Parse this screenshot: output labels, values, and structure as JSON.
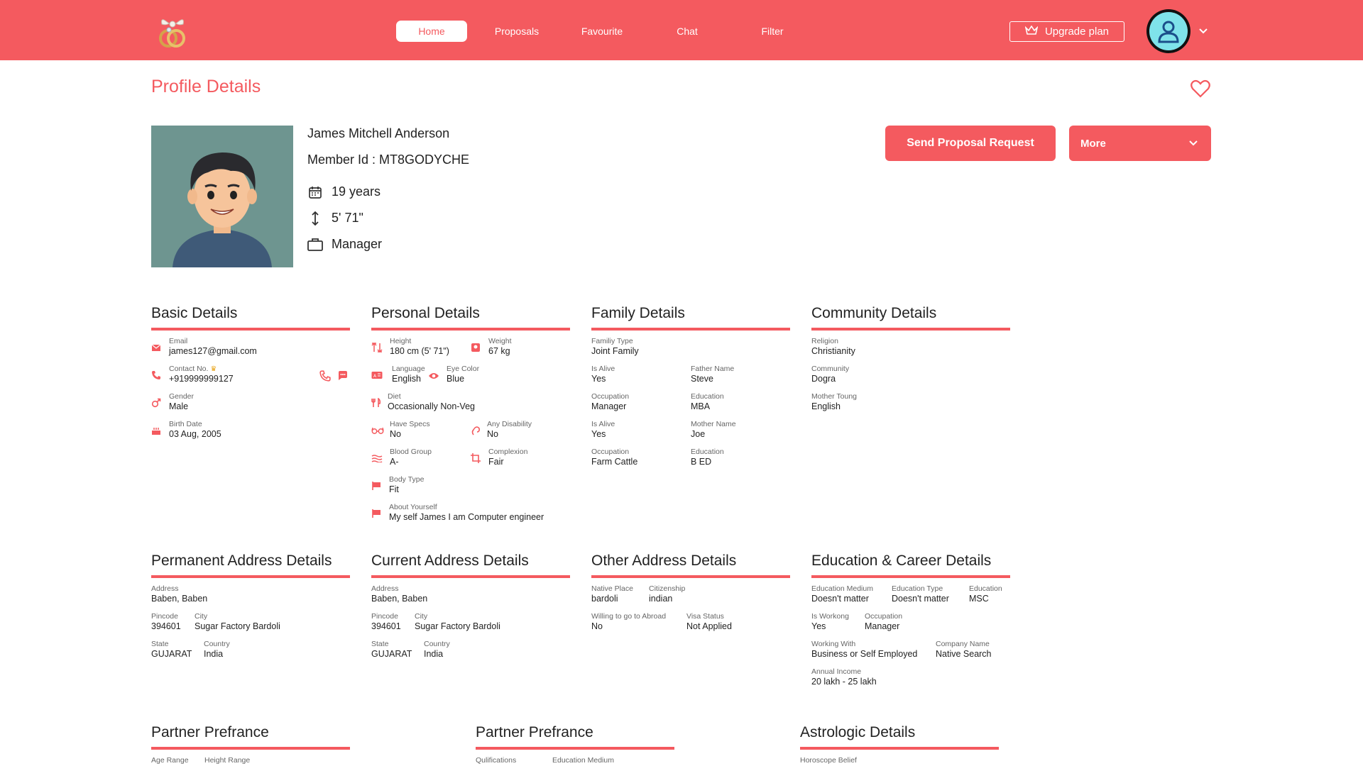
{
  "header": {
    "nav": [
      "Home",
      "Proposals",
      "Favourite",
      "Chat",
      "Filter"
    ],
    "active_nav": "Home",
    "upgrade_label": "Upgrade plan"
  },
  "page_title": "Profile Details",
  "profile": {
    "name": "James Mitchell Anderson",
    "member_id": "Member Id : MT8GODYCHE",
    "age": "19 years",
    "height": "5' 71\"",
    "occupation": "Manager"
  },
  "actions": {
    "send_proposal": "Send Proposal Request",
    "more": "More"
  },
  "basic": {
    "title": "Basic Details",
    "email_label": "Email",
    "email": "james127@gmail.com",
    "contact_label": "Contact No.",
    "contact": "+919999999127",
    "gender_label": "Gender",
    "gender": "Male",
    "birth_label": "Birth Date",
    "birth": "03 Aug, 2005"
  },
  "personal": {
    "title": "Personal Details",
    "height_label": "Height",
    "height": "180 cm (5' 71\")",
    "weight_label": "Weight",
    "weight": "67 kg",
    "language_label": "Language",
    "language": "English",
    "eye_label": "Eye Color",
    "eye": "Blue",
    "diet_label": "Diet",
    "diet": "Occasionally Non-Veg",
    "specs_label": "Have Specs",
    "specs": "No",
    "disability_label": "Any Disability",
    "disability": "No",
    "blood_label": "Blood Group",
    "blood": "A-",
    "complexion_label": "Complexion",
    "complexion": "Fair",
    "body_label": "Body Type",
    "body": "Fit",
    "about_label": "About Yourself",
    "about": "My self James I am Computer engineer"
  },
  "family": {
    "title": "Family Details",
    "type_label": "Familiy Type",
    "type": "Joint Family",
    "alive1_label": "Is Alive",
    "alive1": "Yes",
    "father_label": "Father Name",
    "father": "Steve",
    "occ1_label": "Occupation",
    "occ1": "Manager",
    "edu1_label": "Education",
    "edu1": "MBA",
    "alive2_label": "Is Alive",
    "alive2": "Yes",
    "mother_label": "Mother Name",
    "mother": "Joe",
    "occ2_label": "Occupation",
    "occ2": "Farm Cattle",
    "edu2_label": "Education",
    "edu2": "B ED"
  },
  "community": {
    "title": "Community Details",
    "religion_label": "Religion",
    "religion": "Christianity",
    "community_label": "Community",
    "community": "Dogra",
    "mother_tongue_label": "Mother Toung",
    "mother_tongue": "English"
  },
  "permanent": {
    "title": "Permanent Address Details",
    "address_label": "Address",
    "address": "Baben, Baben",
    "pincode_label": "Pincode",
    "pincode": "394601",
    "city_label": "City",
    "city": "Sugar Factory Bardoli",
    "state_label": "State",
    "state": "GUJARAT",
    "country_label": "Country",
    "country": "India"
  },
  "current": {
    "title": "Current Address Details",
    "address_label": "Address",
    "address": "Baben, Baben",
    "pincode_label": "Pincode",
    "pincode": "394601",
    "city_label": "City",
    "city": "Sugar Factory Bardoli",
    "state_label": "State",
    "state": "GUJARAT",
    "country_label": "Country",
    "country": "India"
  },
  "other_address": {
    "title": "Other Address Details",
    "native_label": "Native Place",
    "native": "bardoli",
    "citizenship_label": "Citizenship",
    "citizenship": "indian",
    "abroad_label": "Willing to go to Abroad",
    "abroad": "No",
    "visa_label": "Visa Status",
    "visa": "Not Applied"
  },
  "education": {
    "title": "Education & Career Details",
    "medium_label": "Education Medium",
    "medium": "Doesn't matter",
    "type_label": "Education Type",
    "type": "Doesn't matter",
    "education_label": "Education",
    "education": "MSC",
    "working_label": "Is Workong",
    "working": "Yes",
    "occupation_label": "Occupation",
    "occupation": "Manager",
    "with_label": "Working With",
    "with": "Business or Self Employed",
    "company_label": "Company Name",
    "company": "Native Search",
    "income_label": "Annual Income",
    "income": "20 lakh - 25 lakh"
  },
  "partner1": {
    "title": "Partner Prefrance",
    "age_label": "Age Range",
    "height_label": "Height Range"
  },
  "partner2": {
    "title": "Partner Prefrance",
    "qual_label": "Qulifications",
    "medium_label": "Education Medium"
  },
  "astro": {
    "title": "Astrologic Details",
    "horoscope_label": "Horoscope Belief"
  },
  "colors": {
    "accent": "#f45a5f"
  }
}
